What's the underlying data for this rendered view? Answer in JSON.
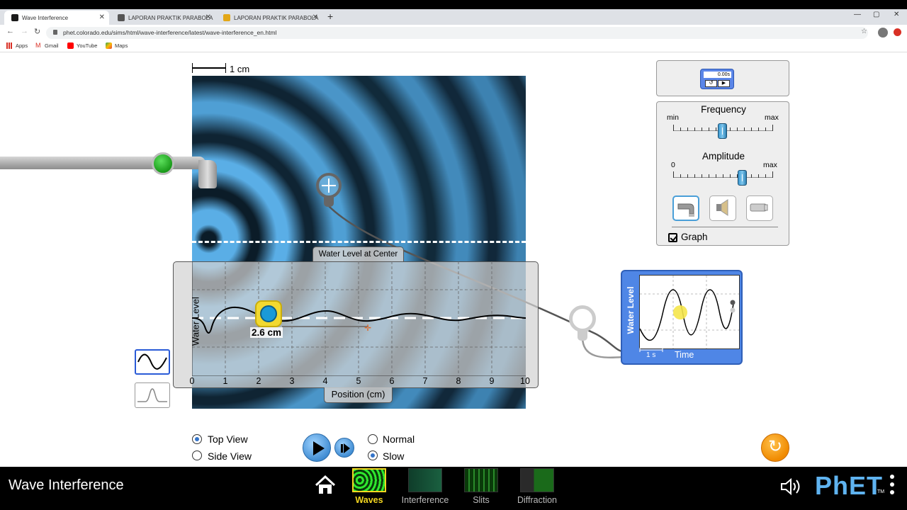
{
  "browser": {
    "tabs": [
      {
        "title": "Wave Interference",
        "favicon_color": "#1a1a1a"
      },
      {
        "title": "LAPORAN PRAKTIK PARABOLA",
        "favicon_color": "#444"
      },
      {
        "title": "LAPORAN PRAKTIK PARABOLA",
        "favicon_color": "#e3a717"
      }
    ],
    "new_tab_symbol": "+",
    "url": "phet.colorado.edu/sims/html/wave-interference/latest/wave-interference_en.html",
    "bookmarks": [
      {
        "label": "Apps",
        "icon": "apps-grid-icon",
        "color": "#d93025"
      },
      {
        "label": "Gmail",
        "icon": "gmail-icon",
        "color": "#d93025"
      },
      {
        "label": "YouTube",
        "icon": "youtube-icon",
        "color": "#ff0000"
      },
      {
        "label": "Maps",
        "icon": "maps-icon",
        "color": "#34a853"
      }
    ]
  },
  "sim": {
    "scale_label": "1 cm",
    "graph": {
      "title": "Water Level at Center",
      "ylabel": "Water Level",
      "xlabel": "Position (cm)",
      "xticks": [
        "0",
        "1",
        "2",
        "3",
        "4",
        "5",
        "6",
        "7",
        "8",
        "9",
        "10"
      ]
    },
    "tape_measure": {
      "reading": "2.6 cm"
    },
    "stopwatch": {
      "display": "0.00s",
      "reset_symbol": "↺",
      "play_symbol": "▶"
    },
    "controls": {
      "frequency": {
        "title": "Frequency",
        "min_label": "min",
        "max_label": "max",
        "level_fraction": 0.49
      },
      "amplitude": {
        "title": "Amplitude",
        "min_label": "0",
        "max_label": "max",
        "level_fraction": 0.69
      },
      "scenes": [
        "water-faucet-icon",
        "speaker-icon",
        "light-source-icon"
      ],
      "graph_checkbox": {
        "label": "Graph",
        "checked": true
      }
    },
    "scope": {
      "ylabel": "Water Level",
      "xlabel": "Time",
      "scale_label": "1 s"
    },
    "view": {
      "top_view": {
        "label": "Top View",
        "selected": true
      },
      "side_view": {
        "label": "Side View",
        "selected": false
      }
    },
    "speed": {
      "normal": {
        "label": "Normal",
        "selected": false
      },
      "slow": {
        "label": "Slow",
        "selected": true
      }
    },
    "reset_symbol": "↻"
  },
  "navbar": {
    "title": "Wave Interference",
    "screens": [
      {
        "label": "Waves",
        "active": true
      },
      {
        "label": "Interference",
        "active": false
      },
      {
        "label": "Slits",
        "active": false
      },
      {
        "label": "Diffraction",
        "active": false
      }
    ],
    "logo": "PhET",
    "logo_tm": "TM",
    "accent_color": "#f2d520"
  }
}
